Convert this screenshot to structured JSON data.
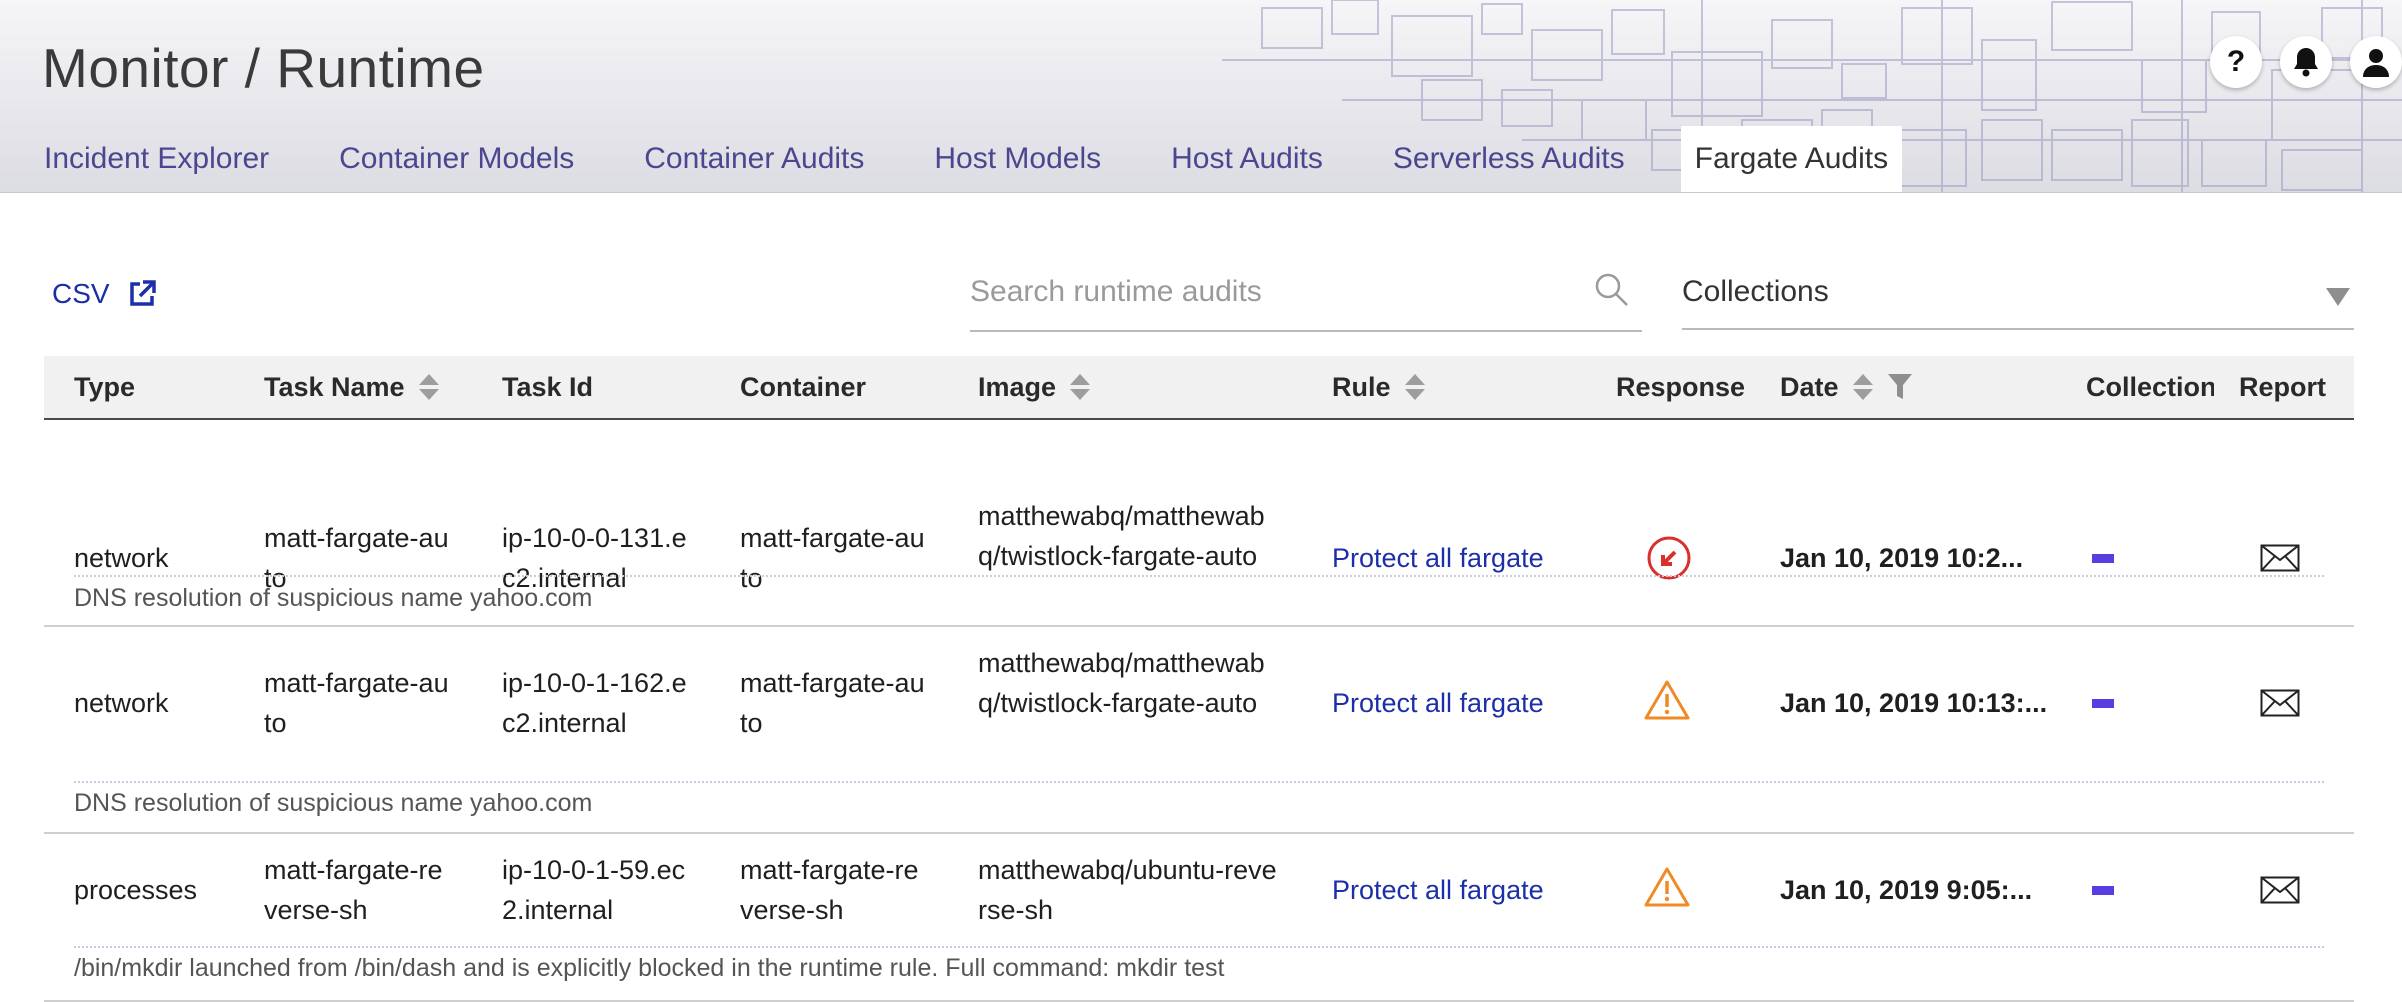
{
  "header": {
    "title": "Monitor / Runtime",
    "icons": [
      "help-icon",
      "bell-icon",
      "user-icon"
    ],
    "help_glyph": "?",
    "tabs": [
      {
        "label": "Incident Explorer",
        "active": false
      },
      {
        "label": "Container Models",
        "active": false
      },
      {
        "label": "Container Audits",
        "active": false
      },
      {
        "label": "Host Models",
        "active": false
      },
      {
        "label": "Host Audits",
        "active": false
      },
      {
        "label": "Serverless Audits",
        "active": false
      },
      {
        "label": "Fargate Audits",
        "active": true
      }
    ]
  },
  "toolbar": {
    "csv_label": "CSV",
    "csv_icon": "external-link-icon",
    "search_placeholder": "Search runtime audits",
    "search_value": "",
    "collections_label": "Collections"
  },
  "table": {
    "columns": [
      "Type",
      "Task Name",
      "Task Id",
      "Container",
      "Image",
      "Rule",
      "Response",
      "Date",
      "Collection",
      "Report"
    ],
    "sortable": [
      "Task Name",
      "Image",
      "Rule",
      "Date"
    ],
    "filterable": [
      "Date"
    ],
    "rows": [
      {
        "type": "network",
        "task_name": "matt-fargate-auto",
        "task_id": "ip-10-0-0-131.ec2.internal",
        "container": "matt-fargate-auto",
        "image": "matthewabq/matthewabq/twistlock-fargate-auto",
        "rule": "Protect all fargate",
        "response": "prevent-icon",
        "date": "Jan 10, 2019 10:2...",
        "description": "DNS resolution of suspicious name yahoo.com"
      },
      {
        "type": "network",
        "task_name": "matt-fargate-auto",
        "task_id": "ip-10-0-1-162.ec2.internal",
        "container": "matt-fargate-auto",
        "image": "matthewabq/matthewabq/twistlock-fargate-auto",
        "rule": "Protect all fargate",
        "response": "alert-icon",
        "date": "Jan 10, 2019 10:13:...",
        "description": "DNS resolution of suspicious name yahoo.com"
      },
      {
        "type": "processes",
        "task_name": "matt-fargate-reverse-sh",
        "task_id": "ip-10-0-1-59.ec2.internal",
        "container": "matt-fargate-reverse-sh",
        "image": "matthewabq/ubuntu-reverse-sh",
        "rule": "Protect all fargate",
        "response": "alert-icon",
        "date": "Jan 10, 2019 9:05:...",
        "description": "/bin/mkdir launched from /bin/dash and is explicitly blocked in the runtime rule. Full command: mkdir test"
      }
    ]
  },
  "colors": {
    "tab_text": "#4a4790",
    "link": "#1d2fa8",
    "prevent": "#d9302c",
    "alert": "#f08a24",
    "collection": "#5a3de0"
  }
}
